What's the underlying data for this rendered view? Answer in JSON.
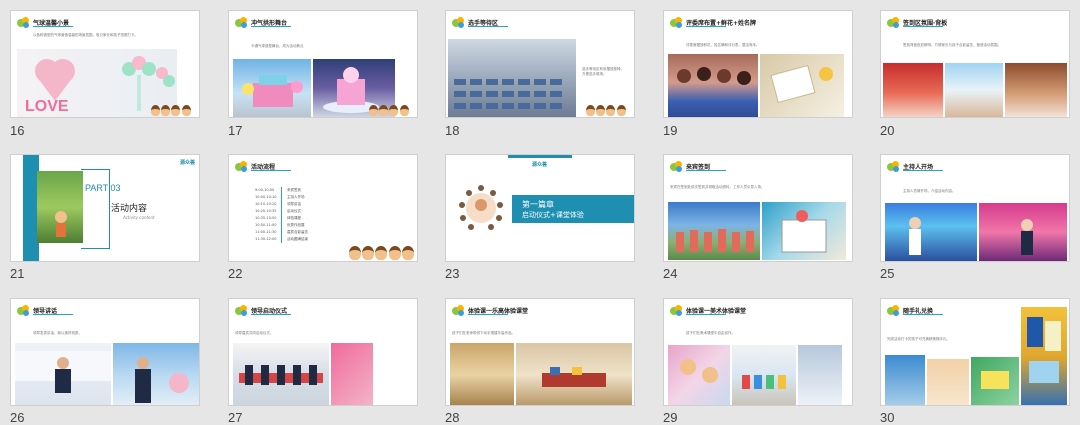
{
  "slides": [
    {
      "num": "16",
      "title": "气球温馨小景",
      "text": "以各种造型的气球营造温馨的场景氛围，吸引家长和孩子拍照打卡。"
    },
    {
      "num": "17",
      "title": "冲气拱形舞台",
      "text": "卡通气球造型舞台，成为活动焦点"
    },
    {
      "num": "18",
      "title": "选手等待区",
      "text": "选手等待区有序摆放座椅，方便选手候场。"
    },
    {
      "num": "19",
      "title": "评委席布置+鲜花+姓名牌",
      "text": "评委席摆放鲜花、姓名牌和评分表，整洁有序。"
    },
    {
      "num": "20",
      "title": "签到区氛围·背板",
      "text": "签到背板色彩鲜明，方便家长与孩子合影留念，营造活动氛围。"
    },
    {
      "num": "21",
      "part": "PART 03",
      "title": "活动内容",
      "subtitle": "Activity content",
      "logo_text": "源众荟"
    },
    {
      "num": "22",
      "title": "活动流程",
      "agenda_times": [
        "9:00-10:00",
        "10:00-10:10",
        "10:10-10:20",
        "10:20-10:35",
        "10:35-10:50",
        "10:50-11:00",
        "11:00-11:30",
        "11:30-12:00"
      ],
      "agenda_items": [
        "来宾签到",
        "主持人开场",
        "领导讲话",
        "启动仪式",
        "体验课程",
        "优秀作品展",
        "嘉宾合影留念",
        "活动圆满结束"
      ]
    },
    {
      "num": "23",
      "chapter": "第一篇章",
      "chapter_sub": "启动仪式+课堂体验",
      "logo_text": "源众荟"
    },
    {
      "num": "24",
      "title": "来宾签到",
      "text": "来宾在签到处依次签到并领取活动资料，工作人员引导入场。"
    },
    {
      "num": "25",
      "title": "主持人开场",
      "text": "主持人热情开场，介绍活动内容。"
    },
    {
      "num": "26",
      "title": "领导讲话",
      "text": "领导发表讲话，致以美好祝愿。"
    },
    {
      "num": "27",
      "title": "领导启动仪式",
      "text": "领导嘉宾共同启动仪式。"
    },
    {
      "num": "28",
      "title": "体验课一乐高体验课堂",
      "text": "孩子们在老师带领下动手搭建乐高作品。"
    },
    {
      "num": "29",
      "title": "体验课一美术体验课堂",
      "text": "孩子们在美术课堂中自由创作。"
    },
    {
      "num": "30",
      "title": "随手礼兑换",
      "text": "完成活动打卡的孩子可兑换精美随手礼。"
    }
  ],
  "colors": {
    "accent": "#2aa3c1",
    "teal": "#1e8fb0",
    "logo_green": "#8cc63f",
    "logo_yellow": "#f7b500",
    "logo_blue": "#3aa0d8"
  }
}
